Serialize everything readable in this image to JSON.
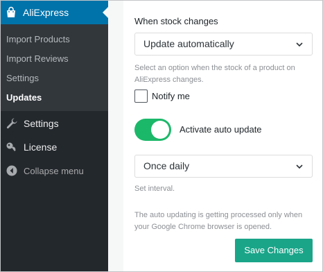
{
  "sidebar": {
    "active_item": {
      "label": "AliExpress",
      "icon": "shopping-bag-icon"
    },
    "submenu": [
      {
        "label": "Import Products"
      },
      {
        "label": "Import Reviews"
      },
      {
        "label": "Settings"
      },
      {
        "label": "Updates",
        "current": true
      }
    ],
    "menu": [
      {
        "label": "Settings",
        "icon": "wrench-icon"
      },
      {
        "label": "License",
        "icon": "key-icon"
      },
      {
        "label": "Collapse menu",
        "icon": "collapse-arrow-icon"
      }
    ],
    "colors": {
      "background": "#23282d",
      "submenu_bg": "#32373c",
      "active": "#0073aa"
    }
  },
  "main": {
    "stock_label": "When stock changes",
    "stock_select_value": "Update automatically",
    "stock_help": "Select an option when the stock of a product on AliExpress changes.",
    "notify_label": "Notify me",
    "notify_checked": false,
    "auto_update_label": "Activate auto update",
    "auto_update_on": true,
    "interval_value": "Once daily",
    "interval_help": "Set interval.",
    "browser_note": "The auto updating is getting processed only when your Google Chrome browser is opened.",
    "save_label": "Save Changes",
    "colors": {
      "toggle": "#1cb86a",
      "save_button": "#1aa589"
    }
  }
}
